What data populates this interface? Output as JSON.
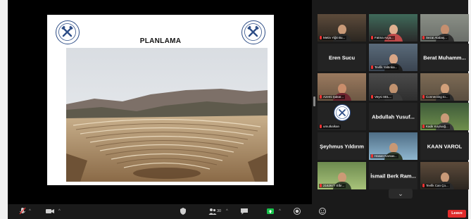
{
  "slide": {
    "title": "PLANLAMA"
  },
  "participants": [
    {
      "display": "video",
      "label": "Metin Yiğit Bu...",
      "active": false
    },
    {
      "display": "video",
      "label": "Fatma Arça...",
      "active": false
    },
    {
      "display": "video",
      "label": "Sezai Atabaş...",
      "active": true
    },
    {
      "display": "name",
      "name": "Eren Sucu",
      "label": ""
    },
    {
      "display": "video",
      "label": "Tevfik Yaltınka...",
      "active": false
    },
    {
      "display": "name",
      "name": "Berat Muhamm...",
      "label": ""
    },
    {
      "display": "video",
      "label": "Azemi Şakar...",
      "active": false
    },
    {
      "display": "video",
      "label": "Veysi SEL...",
      "active": false
    },
    {
      "display": "video",
      "label": "Connecting to...",
      "active": false
    },
    {
      "display": "logo",
      "label": "umutkalkan",
      "active": false
    },
    {
      "display": "name",
      "name": "Abdullah Yusuf...",
      "label": ""
    },
    {
      "display": "video",
      "label": "Kadir Koyluoğ...",
      "active": false
    },
    {
      "display": "name",
      "name": "Şeyhmus Yıldırım",
      "label": ""
    },
    {
      "display": "video",
      "label": "Hasan Karsav...",
      "active": false
    },
    {
      "display": "name",
      "name": "KAAN VAROL",
      "label": ""
    },
    {
      "display": "video",
      "label": "2162677 Elbr...",
      "active": false
    },
    {
      "display": "name",
      "name": "İsmail Berk Ram...",
      "label": ""
    },
    {
      "display": "video",
      "label": "Tevfik Can Ço...",
      "active": false
    }
  ],
  "toolbar": {
    "participants_count": "30",
    "leave_label": "Leave",
    "chevron": "⌄"
  },
  "colors": {
    "toolbar_bg": "#1a1a1a",
    "leave_red": "#e02b2b",
    "active_speaker": "#d8d22c",
    "share_green": "#19c24b",
    "logo_blue": "#2d4d86"
  }
}
